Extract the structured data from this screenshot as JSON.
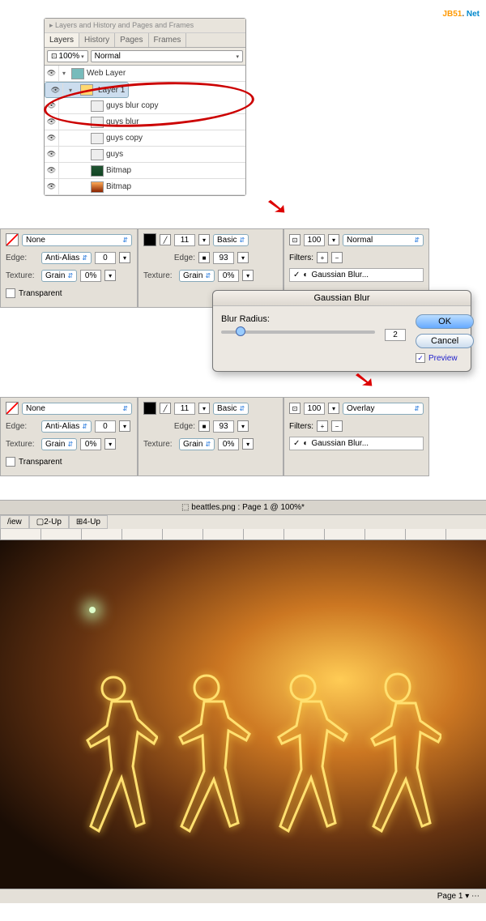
{
  "watermark": {
    "p1": "JB51",
    "p2": ". ",
    "p3": "Net"
  },
  "layersPanel": {
    "title": "▸ Layers and History and Pages and Frames",
    "tabs": [
      "Layers",
      "History",
      "Pages",
      "Frames"
    ],
    "opacity": "100%",
    "blend": "Normal",
    "items": [
      {
        "name": "Web Layer",
        "eye": "👁",
        "exp": "▾",
        "cls": "web"
      },
      {
        "name": "Layer 1",
        "eye": "👁",
        "exp": "▾",
        "cls": "folder",
        "sel": true
      },
      {
        "name": "guys blur copy",
        "eye": "👁",
        "cls": ""
      },
      {
        "name": "guys blur",
        "eye": "👁",
        "cls": ""
      },
      {
        "name": "guys copy",
        "eye": "👁",
        "cls": ""
      },
      {
        "name": "guys",
        "eye": "👁",
        "cls": ""
      },
      {
        "name": "Bitmap",
        "eye": "👁",
        "cls": "bmp1"
      },
      {
        "name": "Bitmap",
        "eye": "👁",
        "cls": "bmp2"
      }
    ]
  },
  "props1": {
    "fill": "None",
    "edgeMode": "Anti-Alias",
    "edgeVal": "0",
    "texture": "Grain",
    "texVal": "0%",
    "transparent": "Transparent",
    "strokeSize": "11",
    "strokeStyle": "Basic",
    "sEdge": "93",
    "sTexture": "Grain",
    "sTexVal": "0%",
    "opacity": "100",
    "blend": "Normal",
    "filters": "Filters:",
    "effect": "Gaussian Blur..."
  },
  "dialog": {
    "title": "Gaussian Blur",
    "label": "Blur Radius:",
    "value": "2",
    "ok": "OK",
    "cancel": "Cancel",
    "preview": "Preview"
  },
  "props2": {
    "fill": "None",
    "edgeMode": "Anti-Alias",
    "edgeVal": "0",
    "texture": "Grain",
    "texVal": "0%",
    "transparent": "Transparent",
    "strokeSize": "11",
    "strokeStyle": "Basic",
    "sEdge": "93",
    "sTexture": "Grain",
    "sTexVal": "0%",
    "opacity": "100",
    "blend": "Overlay",
    "filters": "Filters:",
    "effect": "Gaussian Blur..."
  },
  "canvas": {
    "docTitle": "⬚ beattles.png : Page 1 @ 100%*",
    "views": [
      "/iew",
      "▢2-Up",
      "⊞4-Up"
    ],
    "status": "Page 1 ▾  ⋯"
  },
  "labels": {
    "edge": "Edge:",
    "texture": "Texture:"
  }
}
